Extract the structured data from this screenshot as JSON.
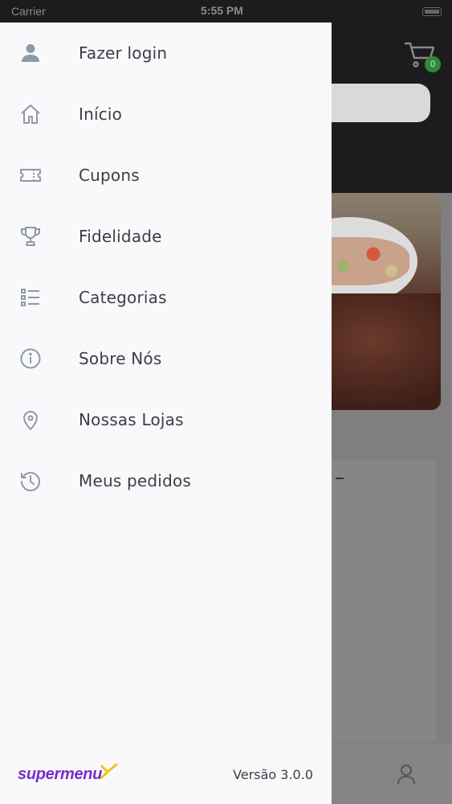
{
  "status_bar": {
    "carrier": "Carrier",
    "time": "5:55 PM"
  },
  "background": {
    "cart_count": "0"
  },
  "menu": {
    "items": [
      {
        "label": "Fazer login",
        "icon": "user-icon"
      },
      {
        "label": "Início",
        "icon": "home-icon"
      },
      {
        "label": "Cupons",
        "icon": "ticket-icon"
      },
      {
        "label": "Fidelidade",
        "icon": "trophy-icon"
      },
      {
        "label": "Categorias",
        "icon": "list-icon"
      },
      {
        "label": "Sobre Nós",
        "icon": "info-icon"
      },
      {
        "label": "Nossas Lojas",
        "icon": "location-pin-icon"
      },
      {
        "label": "Meus pedidos",
        "icon": "history-icon"
      }
    ]
  },
  "footer": {
    "brand": "supermenu",
    "version": "Versão 3.0.0"
  },
  "colors": {
    "brand": "#7a2dc9",
    "accent": "#f2c318",
    "icon": "#8e99a8",
    "text": "#3d3d45",
    "badge": "#2e8b3a"
  }
}
